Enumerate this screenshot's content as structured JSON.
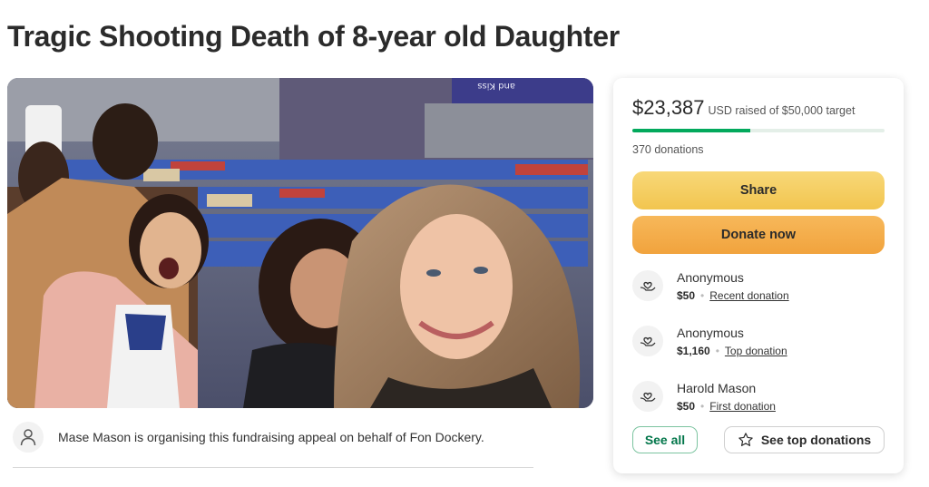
{
  "page": {
    "title": "Tragic Shooting Death of 8-year old Daughter"
  },
  "hero": {
    "image": "family-selfie-at-stadium-photo",
    "background_sign_text": "and Kiss"
  },
  "organiser": {
    "icon": "person-icon",
    "text": "Mase Mason is organising this fundraising appeal on behalf of Fon Dockery."
  },
  "donation_card": {
    "raised": "$23,387",
    "raised_suffix": "USD raised of $50,000 target",
    "progress_fraction": 0.468,
    "donation_count": "370 donations",
    "share_label": "Share",
    "donate_label": "Donate now",
    "donations": [
      {
        "name": "Anonymous",
        "amount": "$50",
        "type": "Recent donation",
        "icon": "heart-hands-icon"
      },
      {
        "name": "Anonymous",
        "amount": "$1,160",
        "type": "Top donation",
        "icon": "heart-hands-icon"
      },
      {
        "name": "Harold Mason",
        "amount": "$50",
        "type": "First donation",
        "icon": "heart-hands-icon"
      }
    ],
    "see_all_label": "See all",
    "see_top_label": "See top donations",
    "colors": {
      "progress": "#02a95c",
      "share": "#f2c54f",
      "donate": "#f1a33d",
      "see_all_text": "#02764a"
    }
  }
}
